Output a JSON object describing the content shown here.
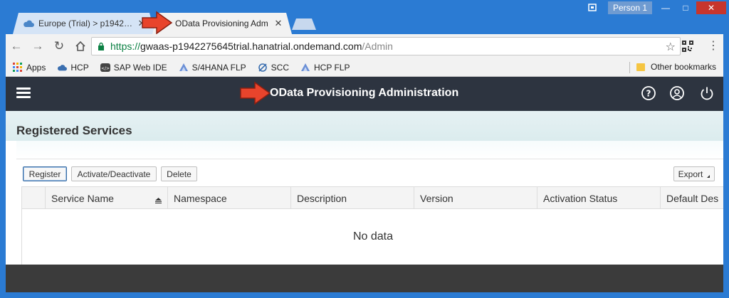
{
  "browser": {
    "tabs": [
      {
        "label": "Europe (Trial) > p1942…",
        "active": false
      },
      {
        "label": "OData Provisioning Adm",
        "active": true
      }
    ],
    "profile": "Person 1",
    "url": {
      "scheme": "https://",
      "host": "gwaas-p1942275645trial.hanatrial.ondemand.com",
      "path": "/Admin"
    },
    "bookmarks": [
      "Apps",
      "HCP",
      "SAP Web IDE",
      "S/4HANA FLP",
      "SCC",
      "HCP FLP"
    ],
    "other_bookmarks": "Other bookmarks"
  },
  "app": {
    "title": "OData Provisioning Administration",
    "page_title": "Registered Services",
    "toolbar": {
      "register": "Register",
      "activate_deactivate": "Activate/Deactivate",
      "delete": "Delete",
      "export": "Export"
    },
    "table": {
      "columns": [
        "Service Name",
        "Namespace",
        "Description",
        "Version",
        "Activation Status",
        "Default Des"
      ],
      "empty_text": "No data"
    }
  },
  "colors": {
    "window_frame": "#2b7bd3",
    "shell_bar": "#2d3440",
    "annotation_arrow": "#e8442c"
  }
}
